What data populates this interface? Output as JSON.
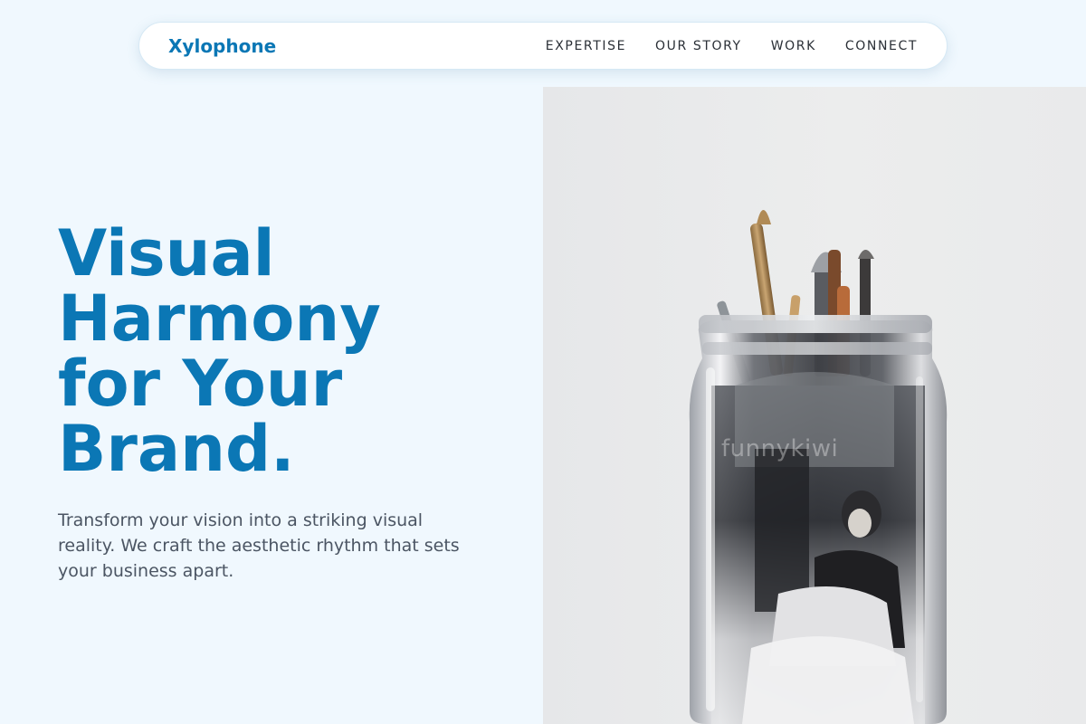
{
  "nav": {
    "brand": "Xylophone",
    "links": [
      {
        "label": "EXPERTISE"
      },
      {
        "label": "OUR STORY"
      },
      {
        "label": "WORK"
      },
      {
        "label": "CONNECT"
      }
    ]
  },
  "hero": {
    "title_lines": [
      "Visual",
      "Harmony",
      "for Your",
      "Brand."
    ],
    "subtitle": "Transform your vision into a striking visual reality. We craft the aesthetic rhythm that sets your business apart."
  },
  "image": {
    "watermark": "funnykiwi",
    "description_icon": "jar-of-brushes-photo"
  },
  "colors": {
    "accent": "#0b77b5",
    "background": "#f0f8fe",
    "text_muted": "#4b5563",
    "nav_text": "#2a2f36"
  }
}
